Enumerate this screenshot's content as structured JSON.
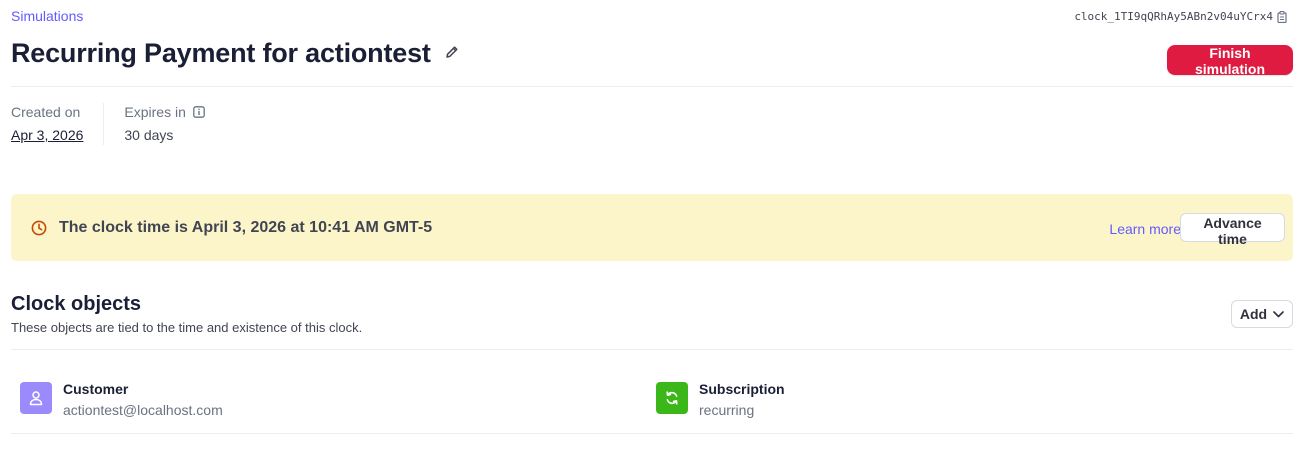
{
  "breadcrumb": "Simulations",
  "clock_id": "clock_1TI9qQRhAy5ABn2v04uYCrx4",
  "title": "Recurring Payment for actiontest",
  "finish_button": "Finish simulation",
  "meta": {
    "created_label": "Created on",
    "created_value": "Apr 3, 2026",
    "expires_label": "Expires in",
    "expires_value": "30 days"
  },
  "banner": {
    "text": "The clock time is April 3, 2026 at 10:41 AM GMT-5",
    "learn_more": "Learn more",
    "advance_button": "Advance time"
  },
  "clock_objects": {
    "title": "Clock objects",
    "subtitle": "These objects are tied to the time and existence of this clock.",
    "add_button": "Add",
    "items": [
      {
        "title": "Customer",
        "subtitle": "actiontest@localhost.com",
        "icon": "person-icon",
        "color": "#9b8afb"
      },
      {
        "title": "Subscription",
        "subtitle": "recurring",
        "icon": "refresh-icon",
        "color": "#3bb71a"
      }
    ]
  },
  "colors": {
    "accent": "#635bff",
    "danger": "#df1b41",
    "banner_bg": "#fcf5c9",
    "banner_icon": "#c84801"
  }
}
